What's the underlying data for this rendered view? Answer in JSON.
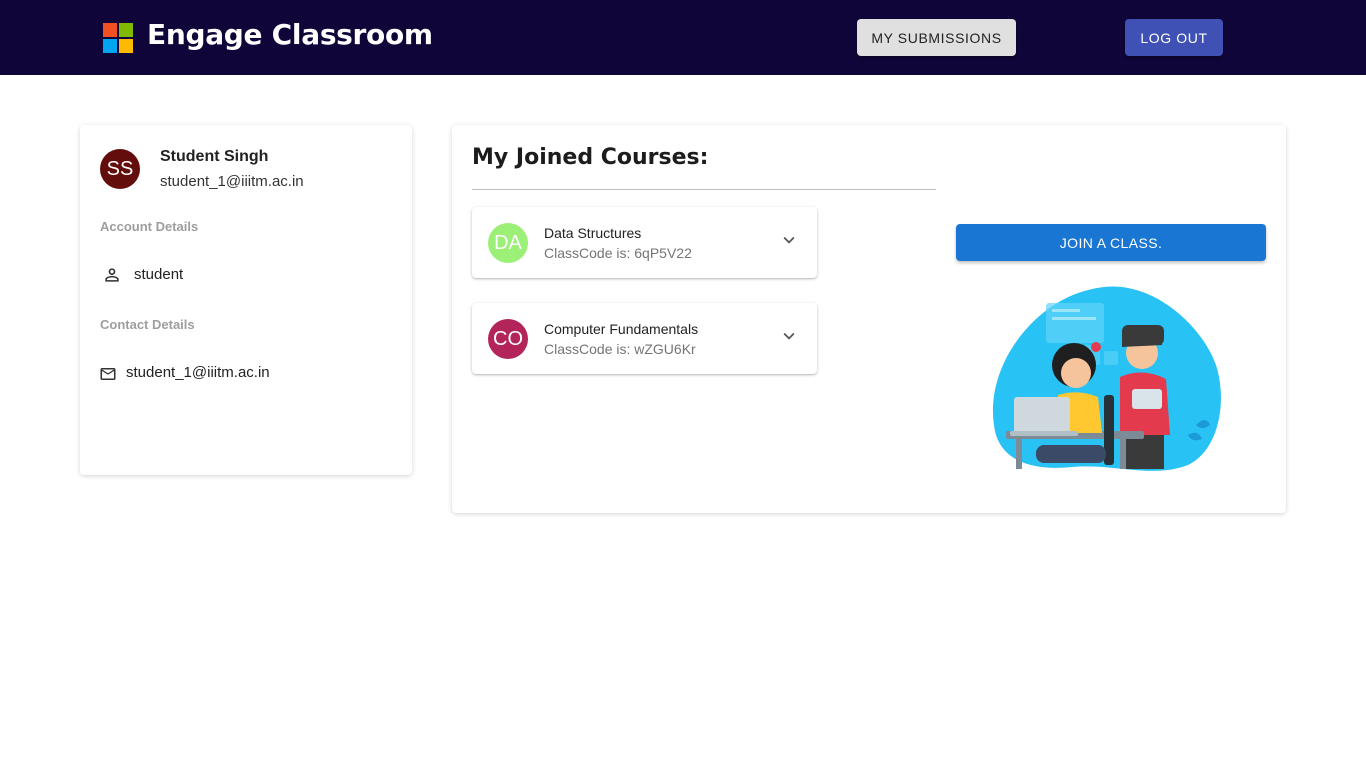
{
  "header": {
    "app_title": "Engage Classroom",
    "submissions_label": "MY SUBMISSIONS",
    "logout_label": "LOG OUT",
    "logo_colors": [
      "#f25022",
      "#7fba00",
      "#00a4ef",
      "#ffb900"
    ],
    "bg_color": "#0f0538"
  },
  "profile": {
    "initials": "SS",
    "name": "Student Singh",
    "email": "student_1@iiitm.ac.in",
    "account_heading": "Account Details",
    "role": "student",
    "contact_heading": "Contact Details",
    "contact_email": "student_1@iiitm.ac.in",
    "role_icon": "person-icon",
    "contact_icon": "mail-icon"
  },
  "courses": {
    "heading": "My Joined Courses:",
    "items": [
      {
        "initials": "DA",
        "name": "Data Structures",
        "code": "ClassCode is: 6qP5V22",
        "color": "#9cef77"
      },
      {
        "initials": "CO",
        "name": "Computer Fundamentals",
        "code": "ClassCode is: wZGU6Kr",
        "color": "#b3245b"
      }
    ],
    "join_label": "JOIN A CLASS.",
    "illustration_icon": "students-at-laptop-illustration"
  }
}
